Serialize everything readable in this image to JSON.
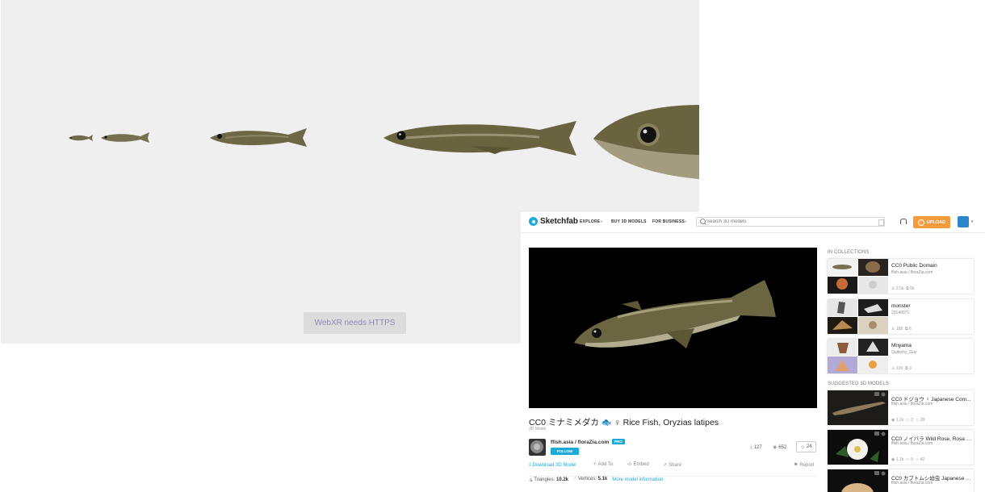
{
  "viewer": {
    "webxr_button": "WebXR needs HTTPS"
  },
  "header": {
    "logo": "Sketchfab",
    "nav": [
      "EXPLORE",
      "BUY 3D MODELS",
      "FOR BUSINESS"
    ],
    "search_placeholder": "Search 3D models",
    "upload_label": "UPLOAD"
  },
  "model": {
    "title": "CC0 ミナミメダカ 🐟 ♀ Rice Fish, Oryzias latipes",
    "subtitle": "3D Model",
    "author": "ffish.asia / floraZia.com",
    "pro_badge": "PRO",
    "follow_label": "FOLLOW",
    "downloads": "127",
    "views": "652",
    "likes": "24",
    "actions": [
      "Download 3D Model",
      "Add To",
      "Embed",
      "Share"
    ],
    "report": "Report",
    "triangles_label": "Triangles:",
    "triangles": "10.2k",
    "vertices_label": "Vertices:",
    "vertices": "5.1k",
    "more_info": "More model information"
  },
  "sidebar": {
    "collections_heading": "IN COLLECTIONS",
    "collections": [
      {
        "title": "CC0 Public Domain",
        "author": "ffish.asia / floraZia.com",
        "likes": "2.5k",
        "models": "5k"
      },
      {
        "title": "monster",
        "author": "23140071",
        "likes": "188",
        "models": "6"
      },
      {
        "title": "Mnyama",
        "author": "Quitschy_Guy",
        "likes": "109",
        "models": "3"
      }
    ],
    "suggested_heading": "SUGGESTED 3D MODELS",
    "suggested": [
      {
        "title": "CC0 ドジョウ ♀ Japanese Com...",
        "author": "ffish.asia / floraZia.com",
        "views": "1.2k",
        "comments": "2",
        "likes": "28"
      },
      {
        "title": "CC0 ノイバラ Wild Rose, Rosa m...",
        "author": "ffish.asia / floraZia.com",
        "views": "1.1k",
        "comments": "0",
        "likes": "42"
      },
      {
        "title": "CC0 カブトムシ幼虫 Japanese R...",
        "author": "ffish.asia / floraZia.com"
      }
    ]
  }
}
